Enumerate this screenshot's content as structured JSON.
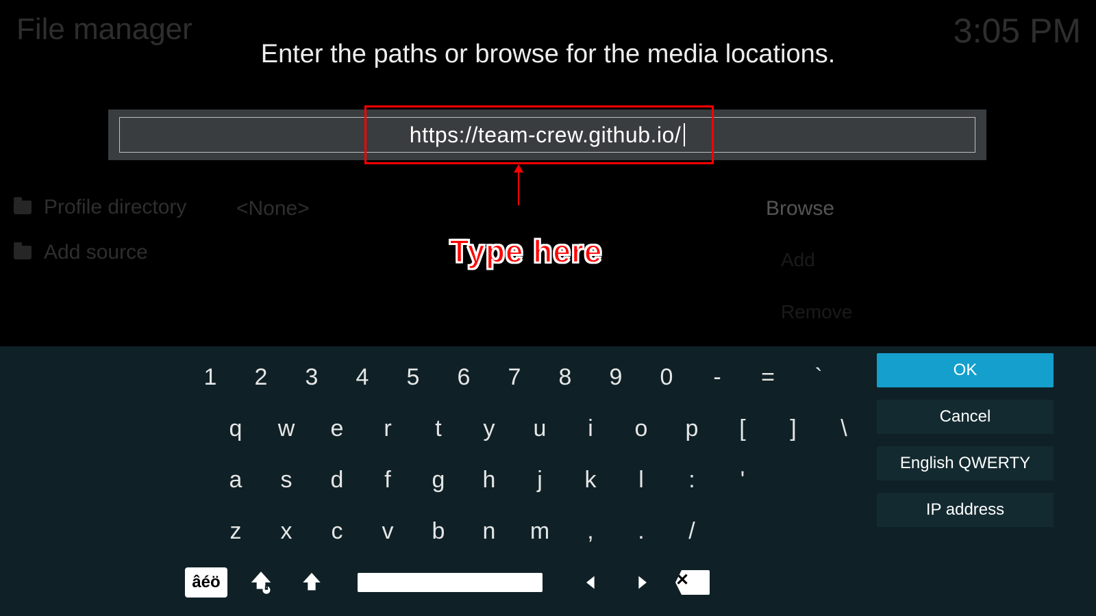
{
  "background": {
    "title": "File manager",
    "clock": "3:05 PM",
    "sidebar": {
      "profile_directory": "Profile directory",
      "add_source": "Add source"
    },
    "none_label": "<None>",
    "browse_label": "Browse",
    "add_label": "Add",
    "remove_label": "Remove"
  },
  "prompt": "Enter the paths or browse for the media locations.",
  "input": {
    "value": "https://team-crew.github.io/"
  },
  "annotation": {
    "label": "Type here"
  },
  "keyboard": {
    "row1": [
      "1",
      "2",
      "3",
      "4",
      "5",
      "6",
      "7",
      "8",
      "9",
      "0",
      "-",
      "=",
      "`"
    ],
    "row2": [
      "q",
      "w",
      "e",
      "r",
      "t",
      "y",
      "u",
      "i",
      "o",
      "p",
      "[",
      "]",
      "\\"
    ],
    "row3": [
      "a",
      "s",
      "d",
      "f",
      "g",
      "h",
      "j",
      "k",
      "l",
      ":",
      "'"
    ],
    "row4": [
      "z",
      "x",
      "c",
      "v",
      "b",
      "n",
      "m",
      ",",
      ".",
      "/"
    ],
    "accent_label": "âéö",
    "backspace_glyph": "✕"
  },
  "actions": {
    "ok": "OK",
    "cancel": "Cancel",
    "layout": "English QWERTY",
    "ip": "IP address"
  }
}
